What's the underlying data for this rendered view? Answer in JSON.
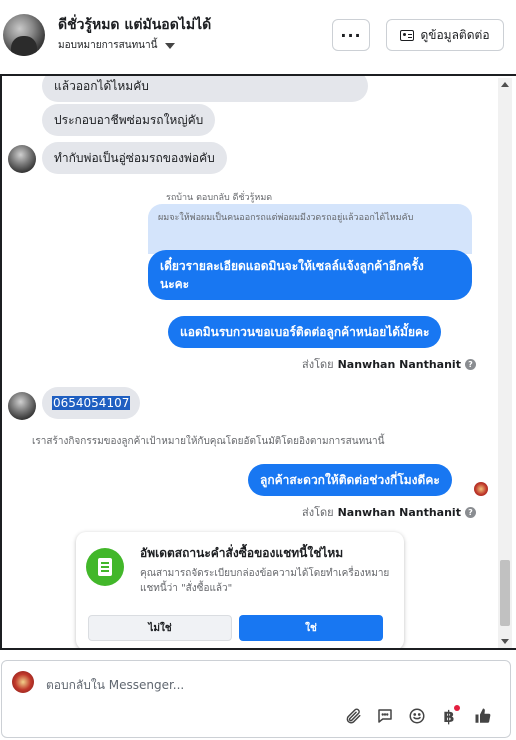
{
  "header": {
    "contact_name": "ดีชั่วรู้หมด แต่มันอดไม่ได้",
    "assign_label": "มอบหมายการสนทนานี้",
    "more_label": "···",
    "contact_info_label": "ดูข้อมูลติดต่อ"
  },
  "messages": {
    "in_1": "แล้วออกได้ไหมคับ",
    "in_2": "ประกอบอาชีพซ่อมรถใหญ่คับ",
    "in_3": "ทำกับพ่อเป็นอู่ซ่อมรถของพ่อคับ",
    "reply_label": "รถบ้าน ตอบกลับ ดีชั่วรู้หมด",
    "reply_quote": "ผมจะให้พ่อผมเป็นคนออกรถแต่พ่อผมมีงวดรถอยู่แล้วออกได้ไหมคับ",
    "out_1_line1": "เดี๋ยวรายละเอียดแอดมินจะให้เซลล์แจ้งลูกค้าอีกครั้ง",
    "out_1_line2": "นะคะ",
    "out_2": "แอดมินรบกวนขอเบอร์ติดต่อลูกค้าหน่อยได้มั้ยคะ",
    "sent_by_prefix": "ส่งโดย",
    "sent_by_name": "Nanwhan Nanthanit",
    "phone": "0654054107",
    "system_notice": "เราสร้างกิจกรรมของลูกค้าเป้าหมายให้กับคุณโดยอัตโนมัติโดยอิงตามการสนทนานี้",
    "out_3": "ลูกค้าสะดวกให้ติดต่อช่วงกี่โมงดีคะ",
    "help_glyph": "?"
  },
  "order_card": {
    "title": "อัพเดตสถานะคำสั่งซื้อของแชทนี้ใช่ไหม",
    "description": "คุณสามารถจัดระเบียบกล่องข้อความได้โดยทำเครื่องหมายแชทนี้ว่า \"สั่งซื้อแล้ว\"",
    "no_label": "ไม่ใช่",
    "yes_label": "ใช่"
  },
  "composer": {
    "placeholder": "ตอบกลับใน Messenger...",
    "currency_symbol": "฿"
  },
  "colors": {
    "accent": "#1877f2",
    "incoming_bubble": "#e4e6eb",
    "quote_bg": "#d4e4fb",
    "order_icon": "#42b72a"
  },
  "icons": [
    "receipt-icon",
    "attach-icon",
    "chat-icon",
    "emoji-icon",
    "baht-icon",
    "like-icon",
    "id-card-icon",
    "chevron-down-icon",
    "help-icon"
  ]
}
